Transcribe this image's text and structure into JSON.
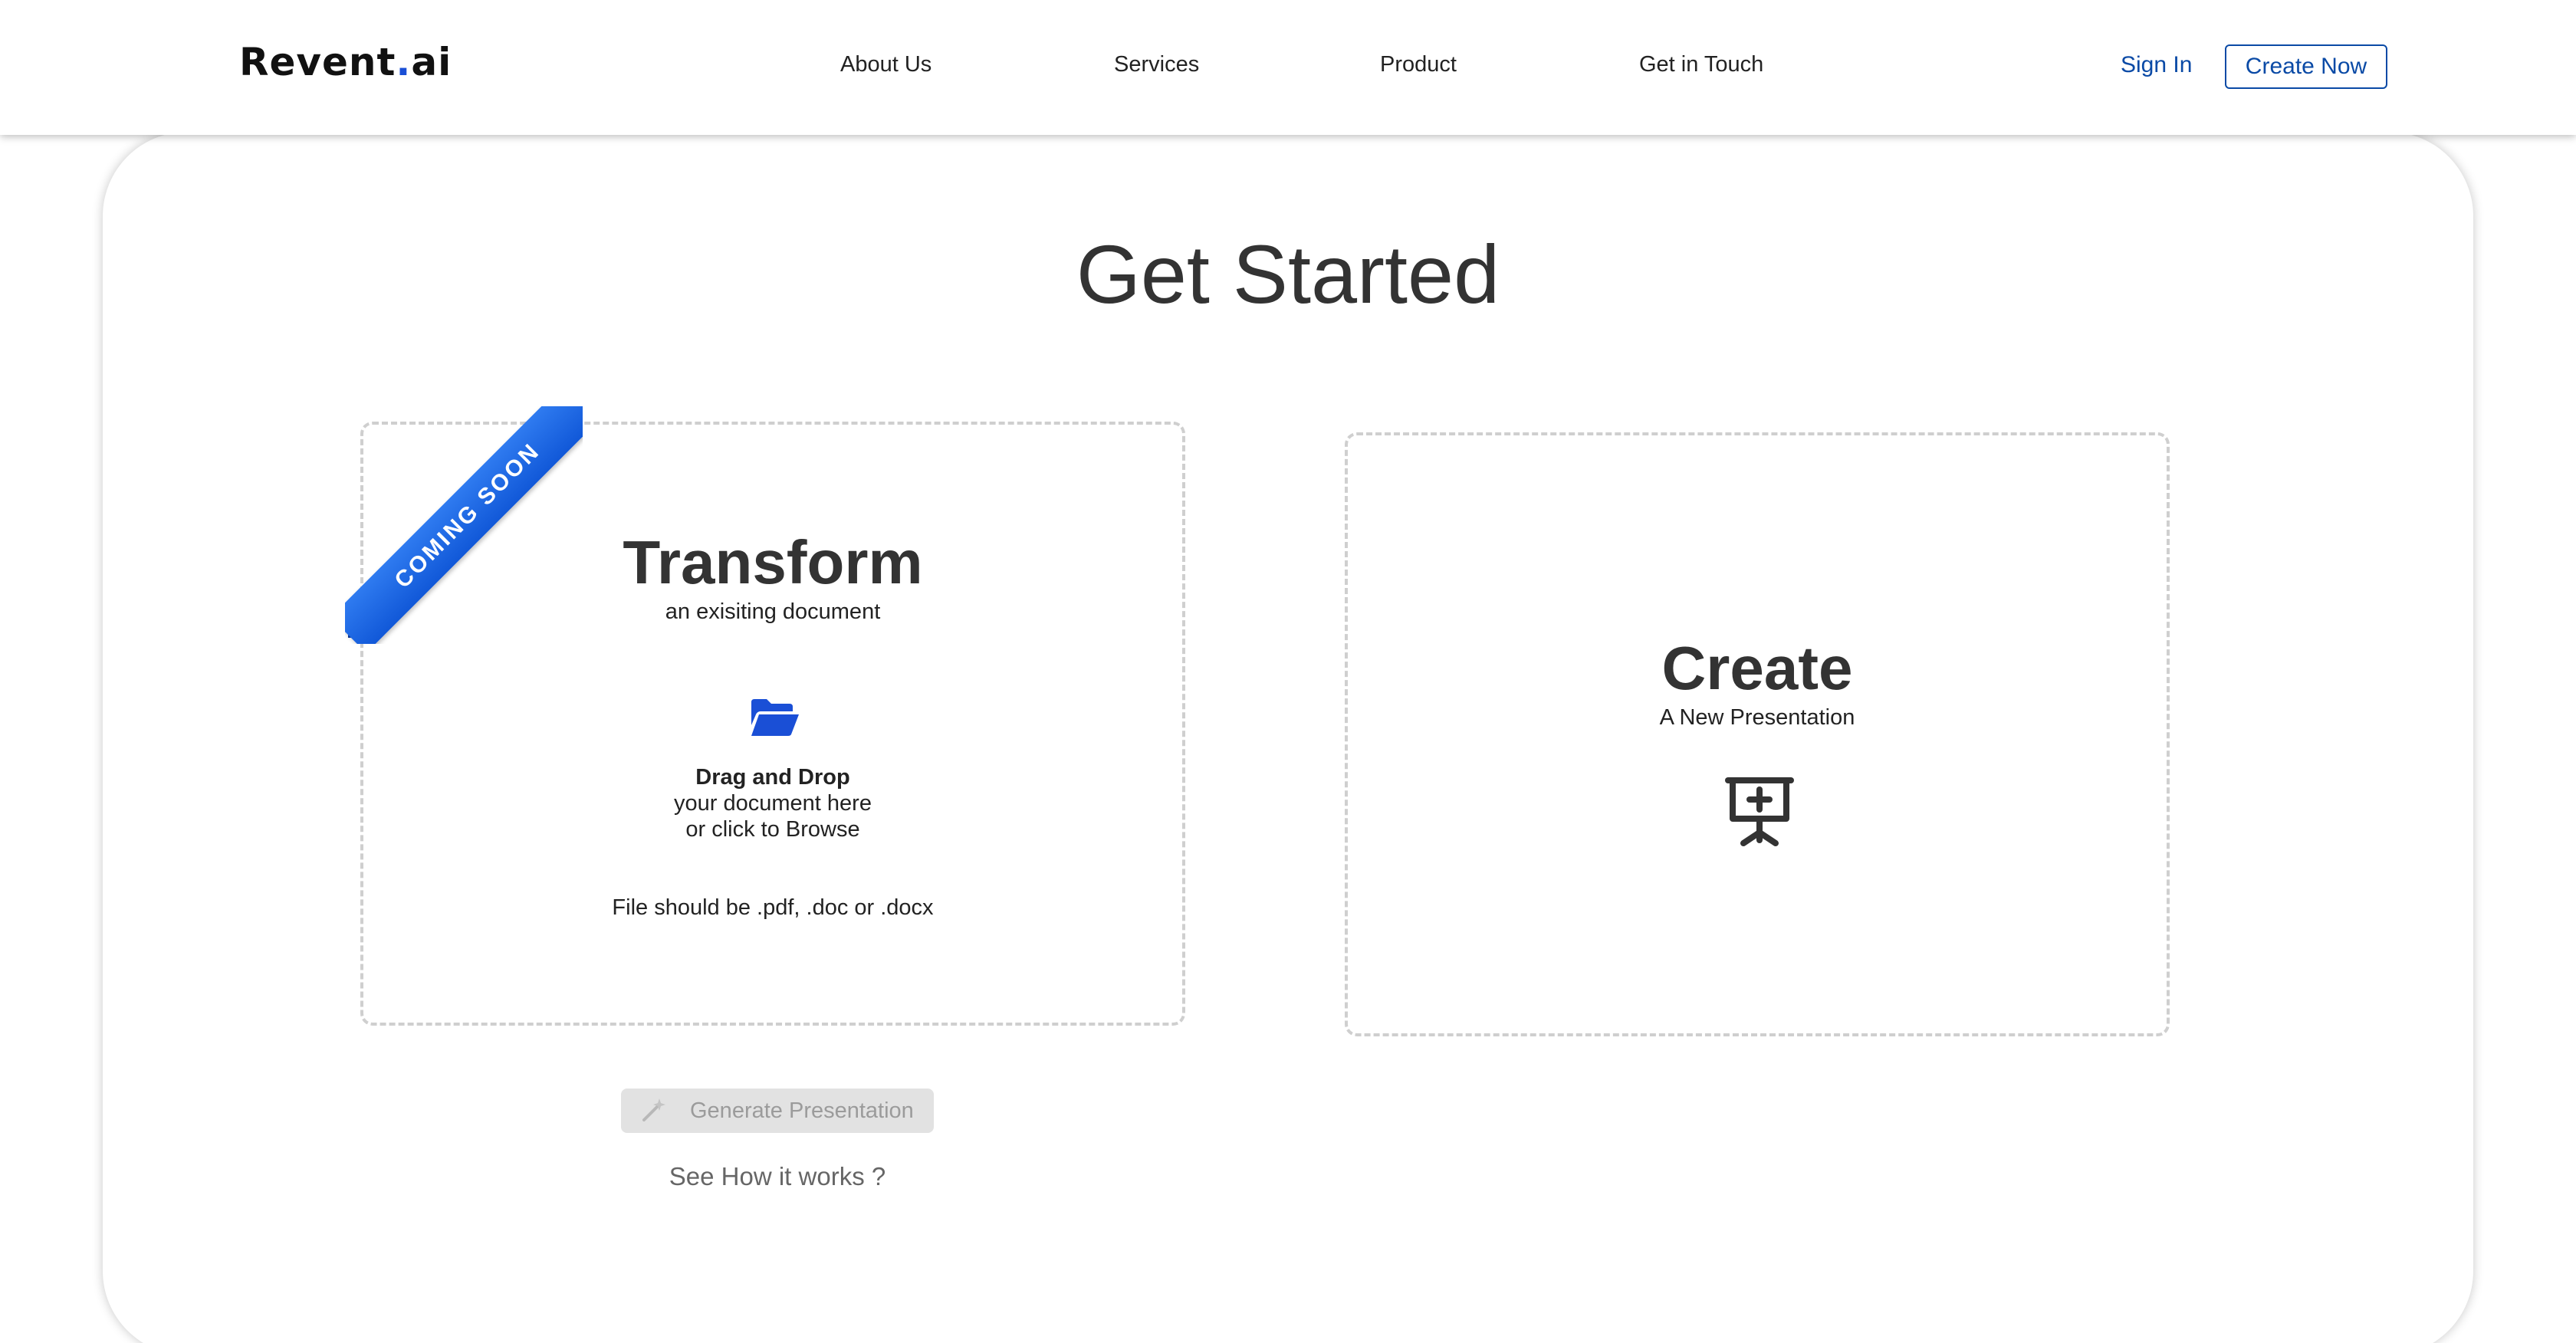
{
  "header": {
    "logo_main": "Revent",
    "logo_dot": ".",
    "logo_suffix": "ai",
    "nav": [
      "About Us",
      "Services",
      "Product",
      "Get in Touch"
    ],
    "sign_in": "Sign In",
    "create_now": "Create Now"
  },
  "main": {
    "title": "Get Started",
    "transform": {
      "ribbon": "COMING SOON",
      "heading": "Transform",
      "subheading": "an exisiting document",
      "icon": "folder-open-icon",
      "drag_drop": "Drag and Drop",
      "drag_line2": "your document here",
      "drag_line3": "or click to Browse",
      "file_hint": "File should be .pdf, .doc or .docx"
    },
    "create": {
      "heading": "Create",
      "subheading": "A New Presentation",
      "icon": "presentation-add-icon"
    },
    "generate_button": "Generate Presentation",
    "generate_icon": "magic-wand-icon",
    "how_link": "See How it works ?"
  },
  "colors": {
    "accent": "#0a4aa6",
    "ribbon": "#1158d8",
    "logo_dot": "#1a4fd6",
    "disabled_bg": "#e2e2e2",
    "disabled_text": "#9b9b9b"
  }
}
